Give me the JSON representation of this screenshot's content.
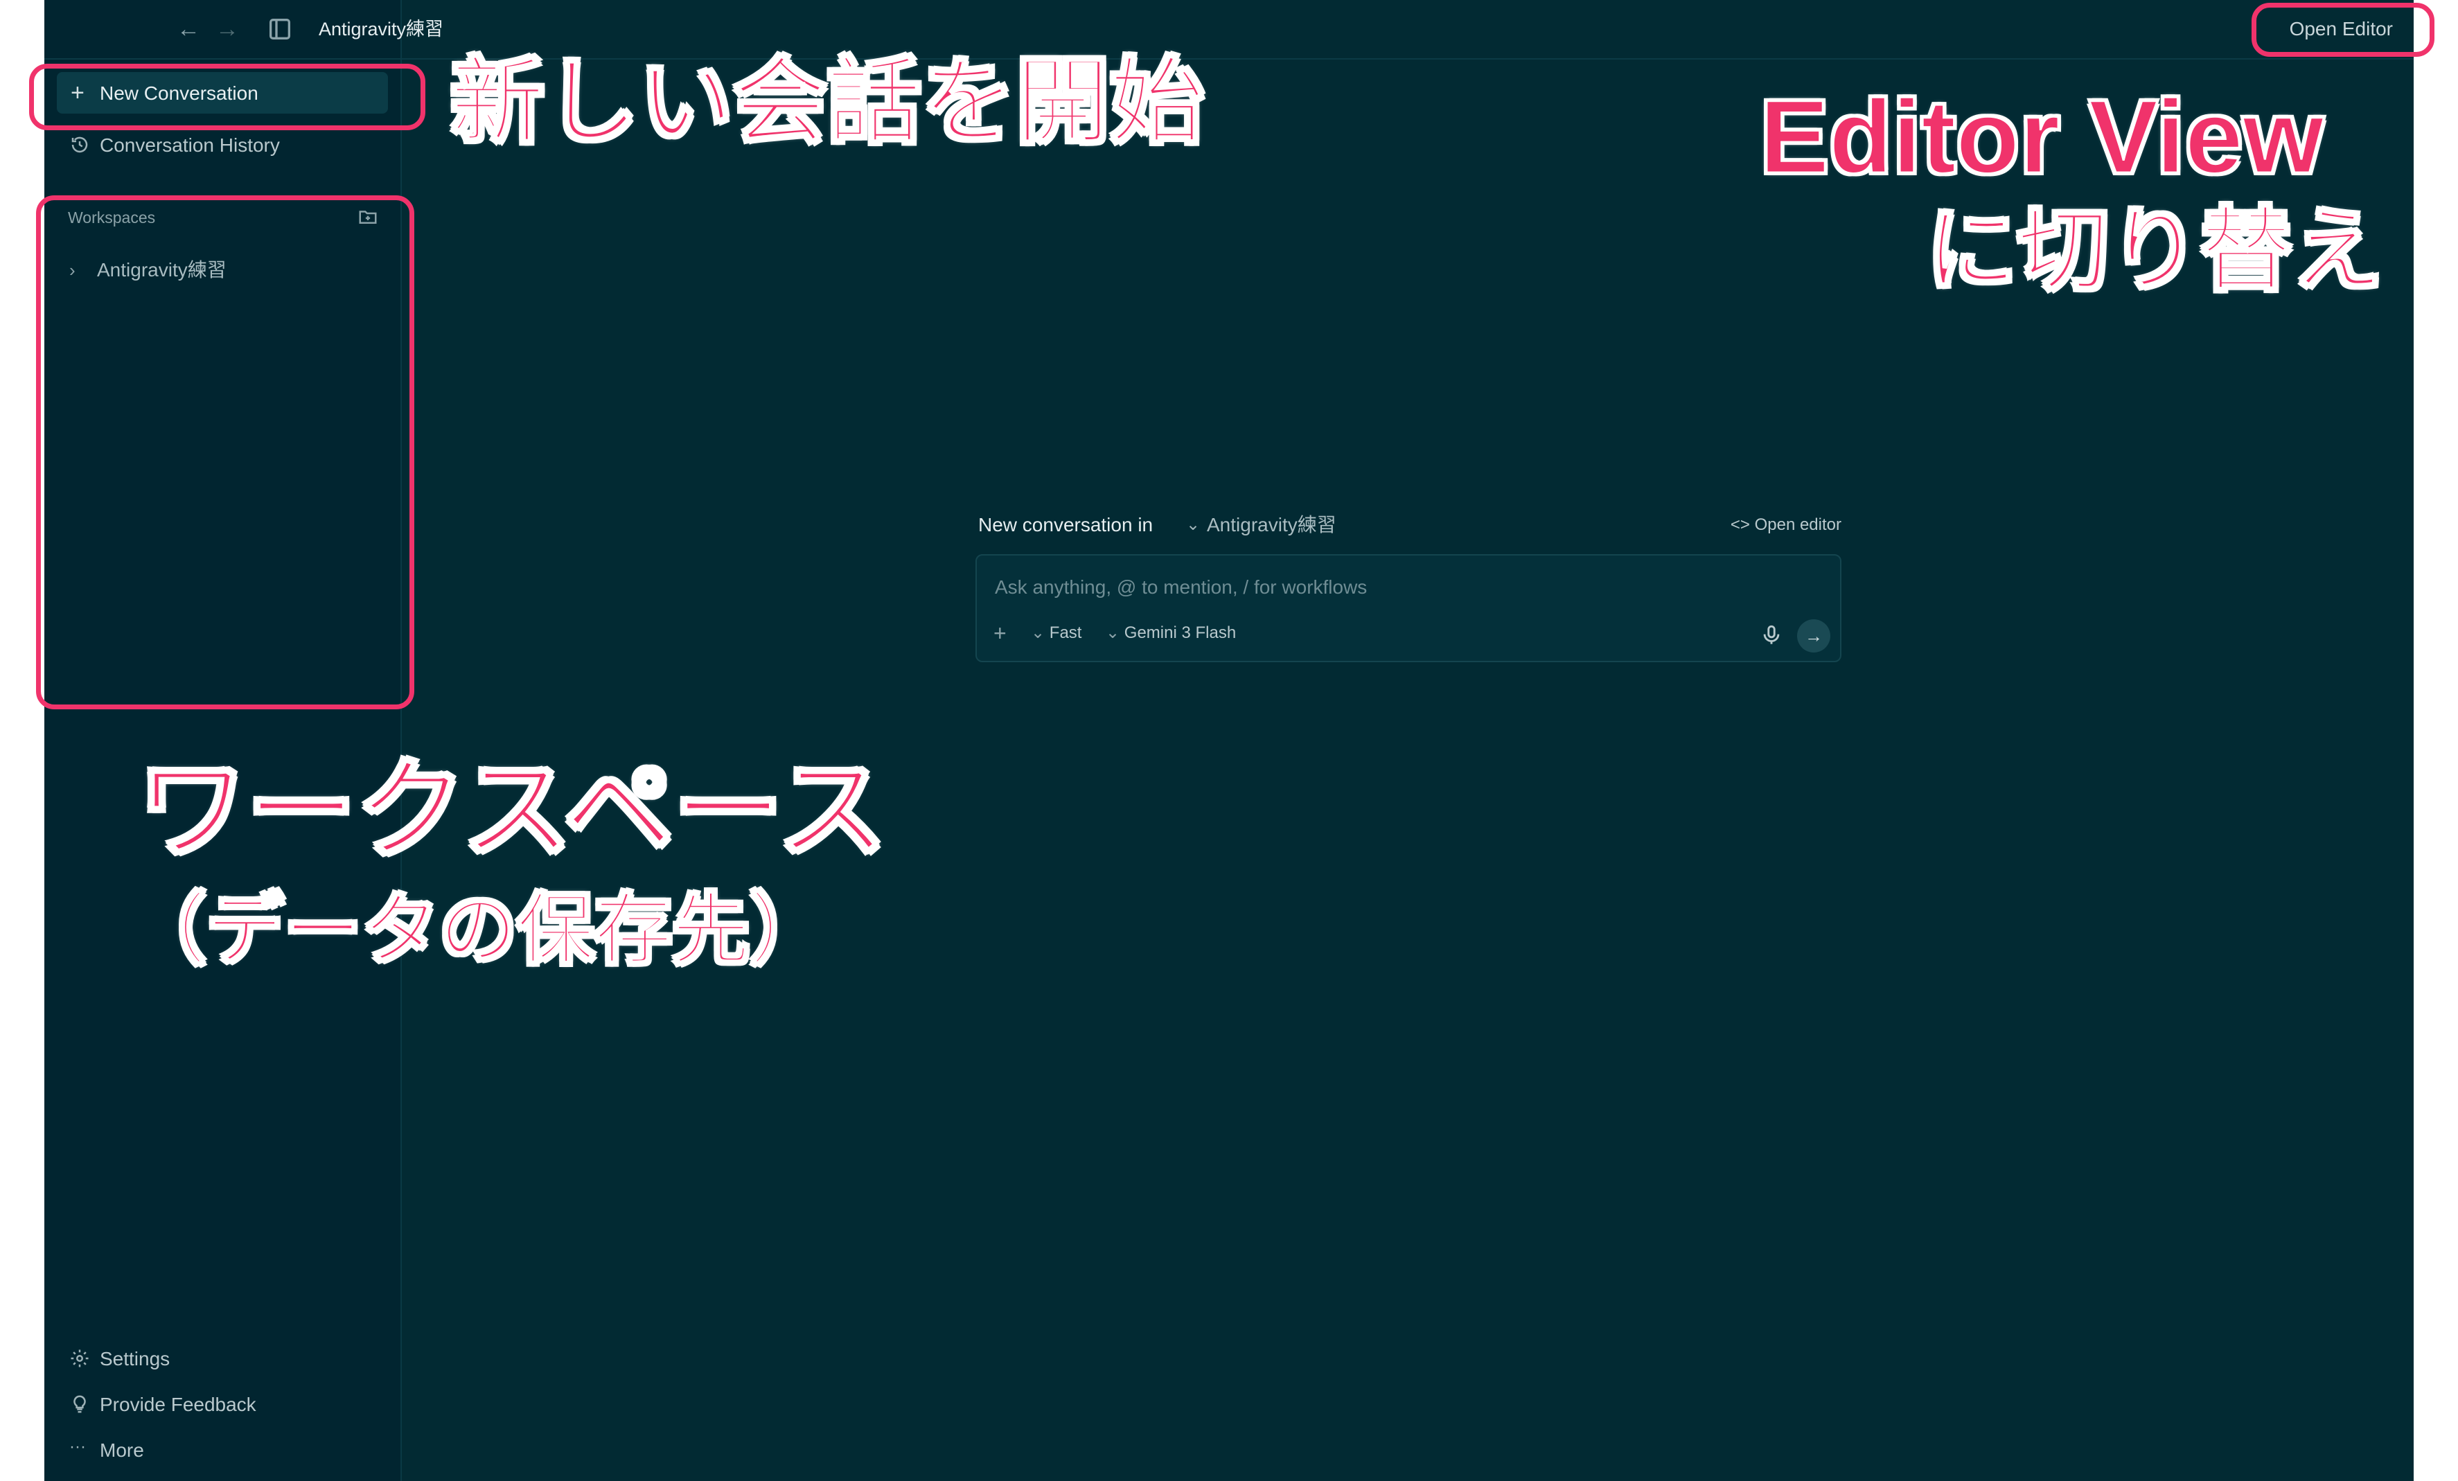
{
  "titlebar": {
    "title": "Antigravity練習",
    "open_editor": "Open Editor"
  },
  "sidebar": {
    "new_conversation": "New Conversation",
    "conversation_history": "Conversation History",
    "workspaces_label": "Workspaces",
    "workspace_item": "Antigravity練習",
    "settings": "Settings",
    "feedback": "Provide Feedback",
    "more": "More"
  },
  "main": {
    "heading": "New conversation in",
    "workspace": "Antigravity練習",
    "open_editor": "Open editor",
    "input_placeholder": "Ask anything, @ to mention, / for workflows",
    "mode": "Fast",
    "model": "Gemini 3 Flash"
  },
  "annotations": {
    "new_conv": "新しい会話を開始",
    "editor_line1": "Editor View",
    "editor_line2": "に切り替え",
    "workspace_line1": "ワークスペース",
    "workspace_line2": "（データの保存先）"
  },
  "colors": {
    "background": "#022a33",
    "sidebar": "#012530",
    "annotation": "#f0336b"
  }
}
